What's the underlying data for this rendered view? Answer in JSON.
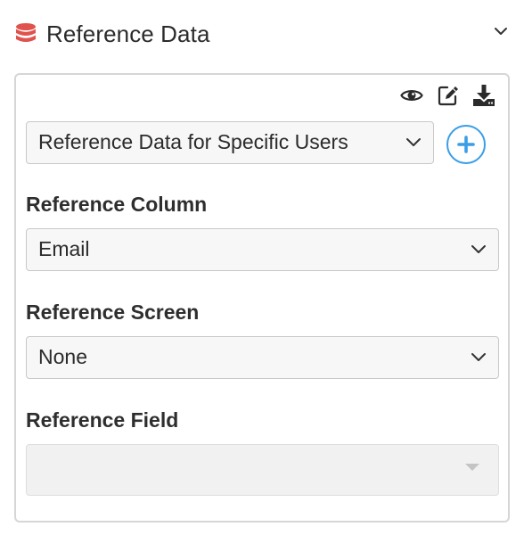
{
  "header": {
    "title": "Reference Data",
    "icon": "database-icon",
    "icon_color": "#e0524d"
  },
  "toolbar": {
    "icons": [
      "eye-icon",
      "edit-icon",
      "download-icon"
    ]
  },
  "dataset": {
    "selected": "Reference Data for Specific Users",
    "add_icon": "plus-icon",
    "accent_color": "#3a9ee6"
  },
  "reference_column": {
    "label": "Reference Column",
    "selected": "Email"
  },
  "reference_screen": {
    "label": "Reference Screen",
    "selected": "None"
  },
  "reference_field": {
    "label": "Reference Field",
    "selected": "",
    "disabled": true
  }
}
